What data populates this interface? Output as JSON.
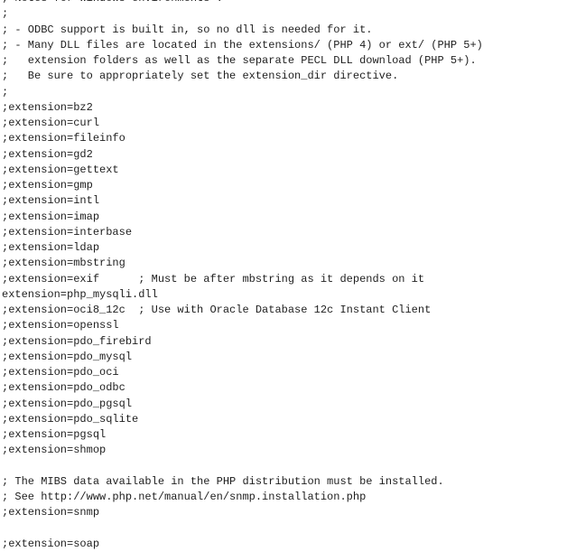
{
  "editor": {
    "lines": [
      "; Notes for Windows environments :",
      ";",
      "; - ODBC support is built in, so no dll is needed for it.",
      "; - Many DLL files are located in the extensions/ (PHP 4) or ext/ (PHP 5+)",
      ";   extension folders as well as the separate PECL DLL download (PHP 5+).",
      ";   Be sure to appropriately set the extension_dir directive.",
      ";",
      ";extension=bz2",
      ";extension=curl",
      ";extension=fileinfo",
      ";extension=gd2",
      ";extension=gettext",
      ";extension=gmp",
      ";extension=intl",
      ";extension=imap",
      ";extension=interbase",
      ";extension=ldap",
      ";extension=mbstring",
      ";extension=exif      ; Must be after mbstring as it depends on it",
      "extension=php_mysqli.dll",
      ";extension=oci8_12c  ; Use with Oracle Database 12c Instant Client",
      ";extension=openssl",
      ";extension=pdo_firebird",
      ";extension=pdo_mysql",
      ";extension=pdo_oci",
      ";extension=pdo_odbc",
      ";extension=pdo_pgsql",
      ";extension=pdo_sqlite",
      ";extension=pgsql",
      ";extension=shmop",
      "",
      "; The MIBS data available in the PHP distribution must be installed.",
      "; See http://www.php.net/manual/en/snmp.installation.php",
      ";extension=snmp",
      "",
      ";extension=soap"
    ]
  }
}
